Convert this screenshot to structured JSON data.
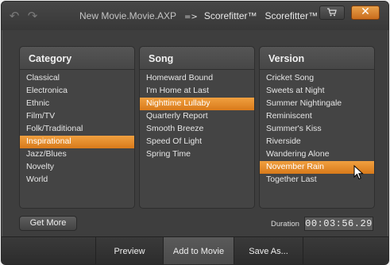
{
  "titlebar": {
    "project": "New Movie.Movie.AXP",
    "separator": "=>",
    "product": "Scorefitter™",
    "product_2": "Scorefitter™",
    "undo_icon": "undo-icon",
    "redo_icon": "redo-icon",
    "cart_icon": "cart-icon",
    "close_label": "✕"
  },
  "category": {
    "header": "Category",
    "items": [
      "Classical",
      "Electronica",
      "Ethnic",
      "Film/TV",
      "Folk/Traditional",
      "Inspirational",
      "Jazz/Blues",
      "Novelty",
      "World"
    ],
    "selected": "Inspirational"
  },
  "song": {
    "header": "Song",
    "items": [
      "Homeward Bound",
      "I'm Home at Last",
      "Nighttime Lullaby",
      "Quarterly Report",
      "Smooth Breeze",
      "Speed Of Light",
      "Spring Time"
    ],
    "selected": "Nighttime Lullaby"
  },
  "version": {
    "header": "Version",
    "items": [
      "Cricket Song",
      "Sweets at Night",
      "Summer Nightingale",
      "Reminiscent",
      "Summer's Kiss",
      "Riverside",
      "Wandering Alone",
      "November Rain",
      "Together Last"
    ],
    "selected": "November Rain"
  },
  "get_more_label": "Get More",
  "duration": {
    "label": "Duration",
    "value": "00:03:56.29"
  },
  "footer": {
    "preview": "Preview",
    "add_to_movie": "Add to Movie",
    "save_as": "Save As...",
    "active": "Add to Movie"
  },
  "colors": {
    "accent": "#e88a2a",
    "background": "#3e3e3e"
  }
}
